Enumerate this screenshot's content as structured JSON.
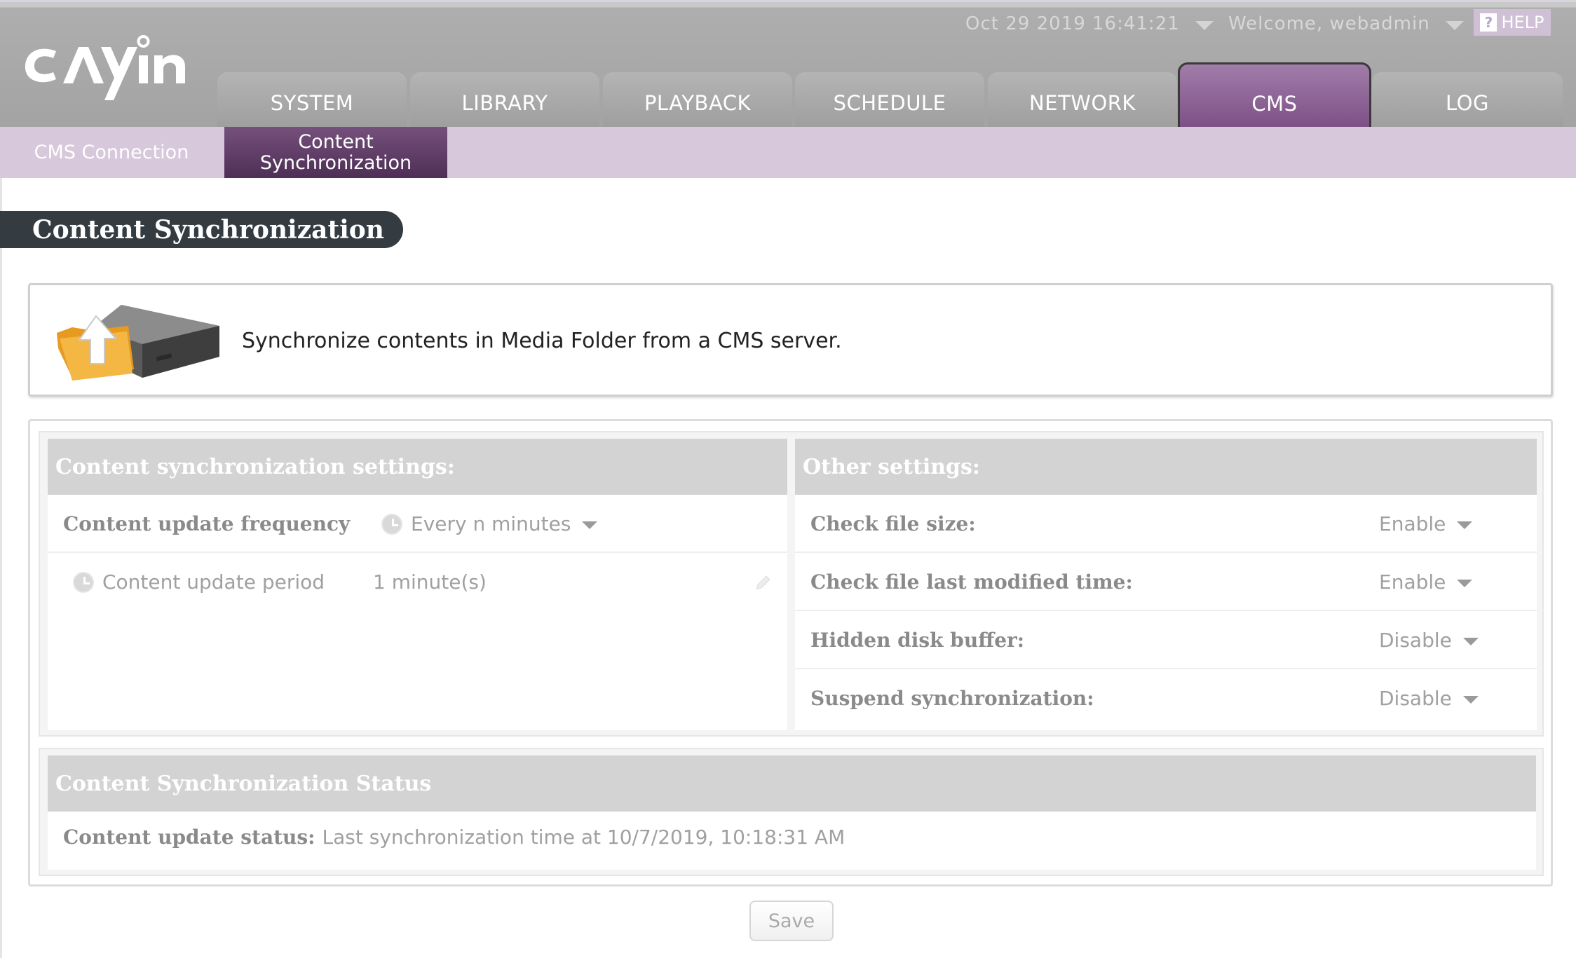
{
  "header": {
    "logo_text": "cayin",
    "datetime": "Oct 29 2019 16:41:21",
    "welcome": "Welcome, webadmin",
    "help_label": "HELP",
    "help_icon_glyph": "?"
  },
  "nav": {
    "tabs": [
      {
        "label": "SYSTEM"
      },
      {
        "label": "LIBRARY"
      },
      {
        "label": "PLAYBACK"
      },
      {
        "label": "SCHEDULE"
      },
      {
        "label": "NETWORK"
      },
      {
        "label": "CMS"
      },
      {
        "label": "LOG"
      }
    ],
    "active_tab": "CMS"
  },
  "subnav": {
    "items": [
      {
        "label": "CMS Connection"
      },
      {
        "label_line1": "Content",
        "label_line2": "Synchronization"
      }
    ],
    "active_item": "Content Synchronization"
  },
  "page": {
    "title": "Content Synchronization",
    "description": "Synchronize contents in Media Folder from a CMS server."
  },
  "sync_settings": {
    "heading": "Content synchronization settings:",
    "frequency_label": "Content update frequency",
    "frequency_value": "Every n minutes",
    "period_label": "Content update period",
    "period_value": "1 minute(s)"
  },
  "other_settings": {
    "heading": "Other settings:",
    "rows": [
      {
        "label": "Check file size:",
        "value": "Enable"
      },
      {
        "label": "Check file last modified time:",
        "value": "Enable"
      },
      {
        "label": "Hidden disk buffer:",
        "value": "Disable"
      },
      {
        "label": "Suspend synchronization:",
        "value": "Disable"
      }
    ]
  },
  "status": {
    "heading": "Content Synchronization Status",
    "label": "Content update status:",
    "value": "Last synchronization time at 10/7/2019, 10:18:31 AM"
  },
  "actions": {
    "save_label": "Save"
  },
  "colors": {
    "accent": "#7c4f85",
    "subnav_bg": "#d8c8dc",
    "header_bg": "#a3a3a3",
    "title_bg": "#353c41"
  },
  "icons": {
    "logo": "cayin-logo",
    "sync": "folder-upload-device-icon",
    "clock": "clock-icon",
    "pencil": "pencil-icon",
    "caret": "chevron-down-icon"
  }
}
